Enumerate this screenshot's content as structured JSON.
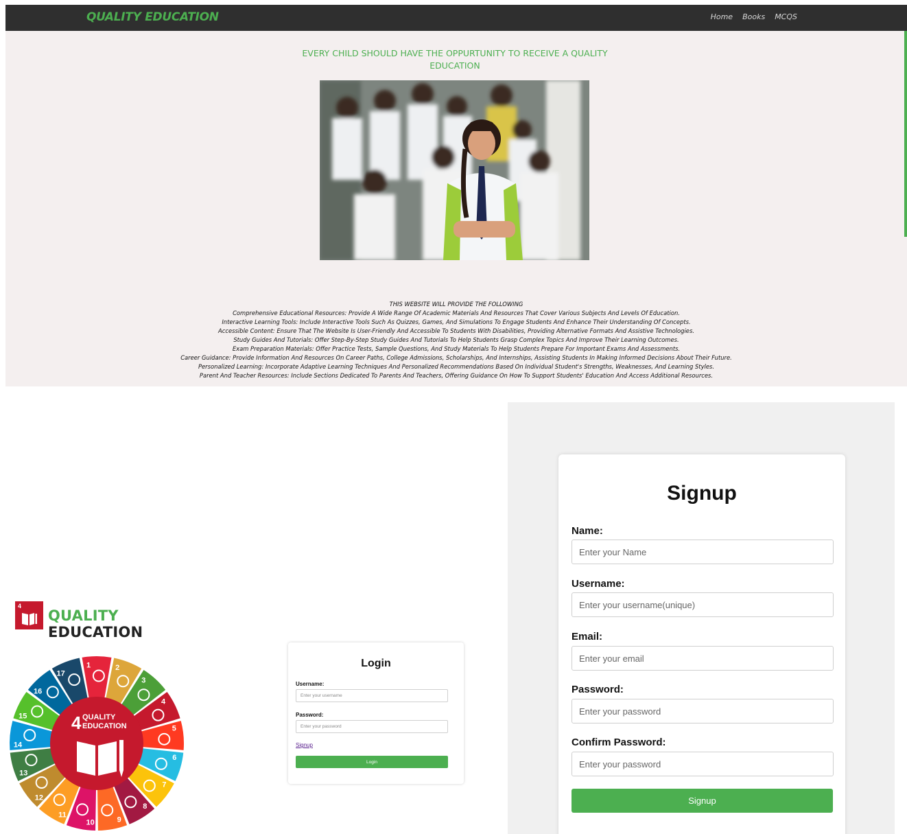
{
  "navbar": {
    "brand": "QUALITY EDUCATION",
    "links": [
      "Home",
      "Books",
      "MCQS"
    ]
  },
  "hero": {
    "headline": "EVERY CHILD SHOULD HAVE THE OPPURTUNITY TO RECEIVE A QUALITY EDUCATION",
    "image_alt": "school children in uniform"
  },
  "features": {
    "heading": "THIS WEBSITE WILL PROVIDE THE FOLLOWING",
    "items": [
      "Comprehensive Educational Resources: Provide A Wide Range Of Academic Materials And Resources That Cover Various Subjects And Levels Of Education.",
      "Interactive Learning Tools: Include Interactive Tools Such As Quizzes, Games, And Simulations To Engage Students And Enhance Their Understanding Of Concepts.",
      "Accessible Content: Ensure That The Website Is User-Friendly And Accessible To Students With Disabilities, Providing Alternative Formats And Assistive Technologies.",
      "Study Guides And Tutorials: Offer Step-By-Step Study Guides And Tutorials To Help Students Grasp Complex Topics And Improve Their Learning Outcomes.",
      "Exam Preparation Materials: Offer Practice Tests, Sample Questions, And Study Materials To Help Students Prepare For Important Exams And Assessments.",
      "Career Guidance: Provide Information And Resources On Career Paths, College Admissions, Scholarships, And Internships, Assisting Students In Making Informed Decisions About Their Future.",
      "Personalized Learning: Incorporate Adaptive Learning Techniques And Personalized Recommendations Based On Individual Student's Strengths, Weaknesses, And Learning Styles.",
      "Parent And Teacher Resources: Include Sections Dedicated To Parents And Teachers, Offering Guidance On How To Support Students' Education And Access Additional Resources."
    ]
  },
  "sdg": {
    "badge_number": "4",
    "title_quality": "QUALITY",
    "title_education": "EDUCATION",
    "wheel_center_number": "4",
    "wheel_center_line1": "QUALITY",
    "wheel_center_line2": "EDUCATION",
    "goal_numbers": [
      "1",
      "2",
      "3",
      "4",
      "5",
      "6",
      "7",
      "8",
      "9",
      "10",
      "11",
      "12",
      "13",
      "14",
      "15",
      "16",
      "17"
    ],
    "goal_colors": [
      "#e5243b",
      "#dda63a",
      "#4c9f38",
      "#c5192d",
      "#ff3a21",
      "#26bde2",
      "#fcc30b",
      "#a21942",
      "#fd6925",
      "#dd1367",
      "#fd9d24",
      "#bf8b2e",
      "#3f7e44",
      "#0a97d9",
      "#56c02b",
      "#00689d",
      "#19486a"
    ]
  },
  "login": {
    "title": "Login",
    "username_label": "Username:",
    "username_placeholder": "Enter your username",
    "password_label": "Password:",
    "password_placeholder": "Enter your password",
    "signup_link": "Signup",
    "button": "Login"
  },
  "signup": {
    "title": "Signup",
    "name_label": "Name:",
    "name_placeholder": "Enter your Name",
    "username_label": "Username:",
    "username_placeholder": "Enter your username(unique)",
    "email_label": "Email:",
    "email_placeholder": "Enter your email",
    "password_label": "Password:",
    "password_placeholder": "Enter your password",
    "confirm_label": "Confirm Password:",
    "confirm_placeholder": "Enter your password",
    "button": "Signup"
  },
  "colors": {
    "accent": "#4caf50",
    "navbar_bg": "#2f2f2f",
    "page_bg": "#f4efef",
    "sdg_red": "#c5192d"
  }
}
